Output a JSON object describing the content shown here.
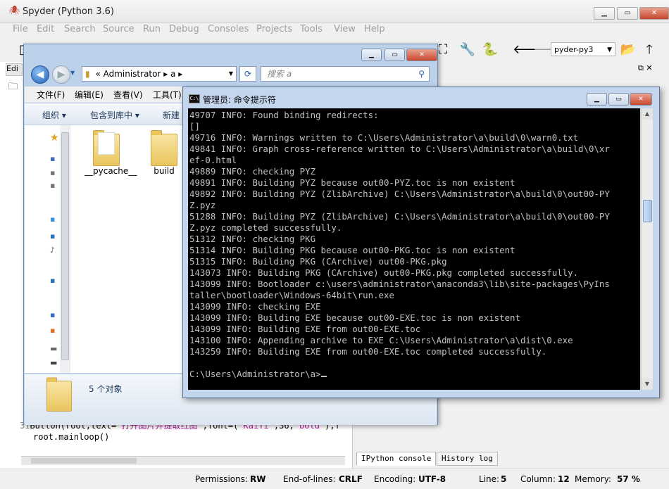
{
  "spyder": {
    "title": "Spyder (Python 3.6)",
    "menu": [
      "File",
      "Edit",
      "Search",
      "Source",
      "Run",
      "Debug",
      "Consoles",
      "Projects",
      "Tools",
      "View",
      "Help"
    ],
    "env": "pyder-py3",
    "editor_tab": "Edi",
    "code": {
      "line31_num": "31",
      "line31_a": "Button(root,text=",
      "line31_str": "'打开图片并提取红图'",
      "line31_b": ",font=(",
      "line31_str2": "'KaiTi'",
      "line31_c": ",36,",
      "line31_str3": "'bold'",
      "line31_d": "),f",
      "line32": "root.mainloop()"
    },
    "console_tabs": [
      "IPython console",
      "History log"
    ],
    "status": {
      "permissions_label": "Permissions:",
      "permissions": "RW",
      "eol_label": "End-of-lines:",
      "eol": "CRLF",
      "encoding_label": "Encoding:",
      "encoding": "UTF-8",
      "line_label": "Line:",
      "line": "5",
      "column_label": "Column:",
      "column": "12",
      "memory_label": "Memory:",
      "memory": "57 %"
    }
  },
  "explorer": {
    "address": "« Administrator ▸ a ▸",
    "search_placeholder": "搜索 a",
    "menu": [
      "文件(F)",
      "编辑(E)",
      "查看(V)",
      "工具(T)"
    ],
    "commands": [
      "组织 ▾",
      "包含到库中 ▾",
      "新建"
    ],
    "folders": [
      "__pycache__",
      "build"
    ],
    "item_count": "5 个对象"
  },
  "cmd": {
    "title": "管理员: 命令提示符",
    "lines": [
      "49707 INFO: Found binding redirects:",
      "[]",
      "49716 INFO: Warnings written to C:\\Users\\Administrator\\a\\build\\0\\warn0.txt",
      "49841 INFO: Graph cross-reference written to C:\\Users\\Administrator\\a\\build\\0\\xr",
      "ef-0.html",
      "49889 INFO: checking PYZ",
      "49891 INFO: Building PYZ because out00-PYZ.toc is non existent",
      "49892 INFO: Building PYZ (ZlibArchive) C:\\Users\\Administrator\\a\\build\\0\\out00-PY",
      "Z.pyz",
      "51288 INFO: Building PYZ (ZlibArchive) C:\\Users\\Administrator\\a\\build\\0\\out00-PY",
      "Z.pyz completed successfully.",
      "51312 INFO: checking PKG",
      "51314 INFO: Building PKG because out00-PKG.toc is non existent",
      "51315 INFO: Building PKG (CArchive) out00-PKG.pkg",
      "143073 INFO: Building PKG (CArchive) out00-PKG.pkg completed successfully.",
      "143099 INFO: Bootloader c:\\users\\administrator\\anaconda3\\lib\\site-packages\\PyIns",
      "taller\\bootloader\\Windows-64bit\\run.exe",
      "143099 INFO: checking EXE",
      "143099 INFO: Building EXE because out00-EXE.toc is non existent",
      "143099 INFO: Building EXE from out00-EXE.toc",
      "143100 INFO: Appending archive to EXE C:\\Users\\Administrator\\a\\dist\\0.exe",
      "143259 INFO: Building EXE from out00-EXE.toc completed successfully.",
      "",
      "C:\\Users\\Administrator\\a>"
    ]
  }
}
